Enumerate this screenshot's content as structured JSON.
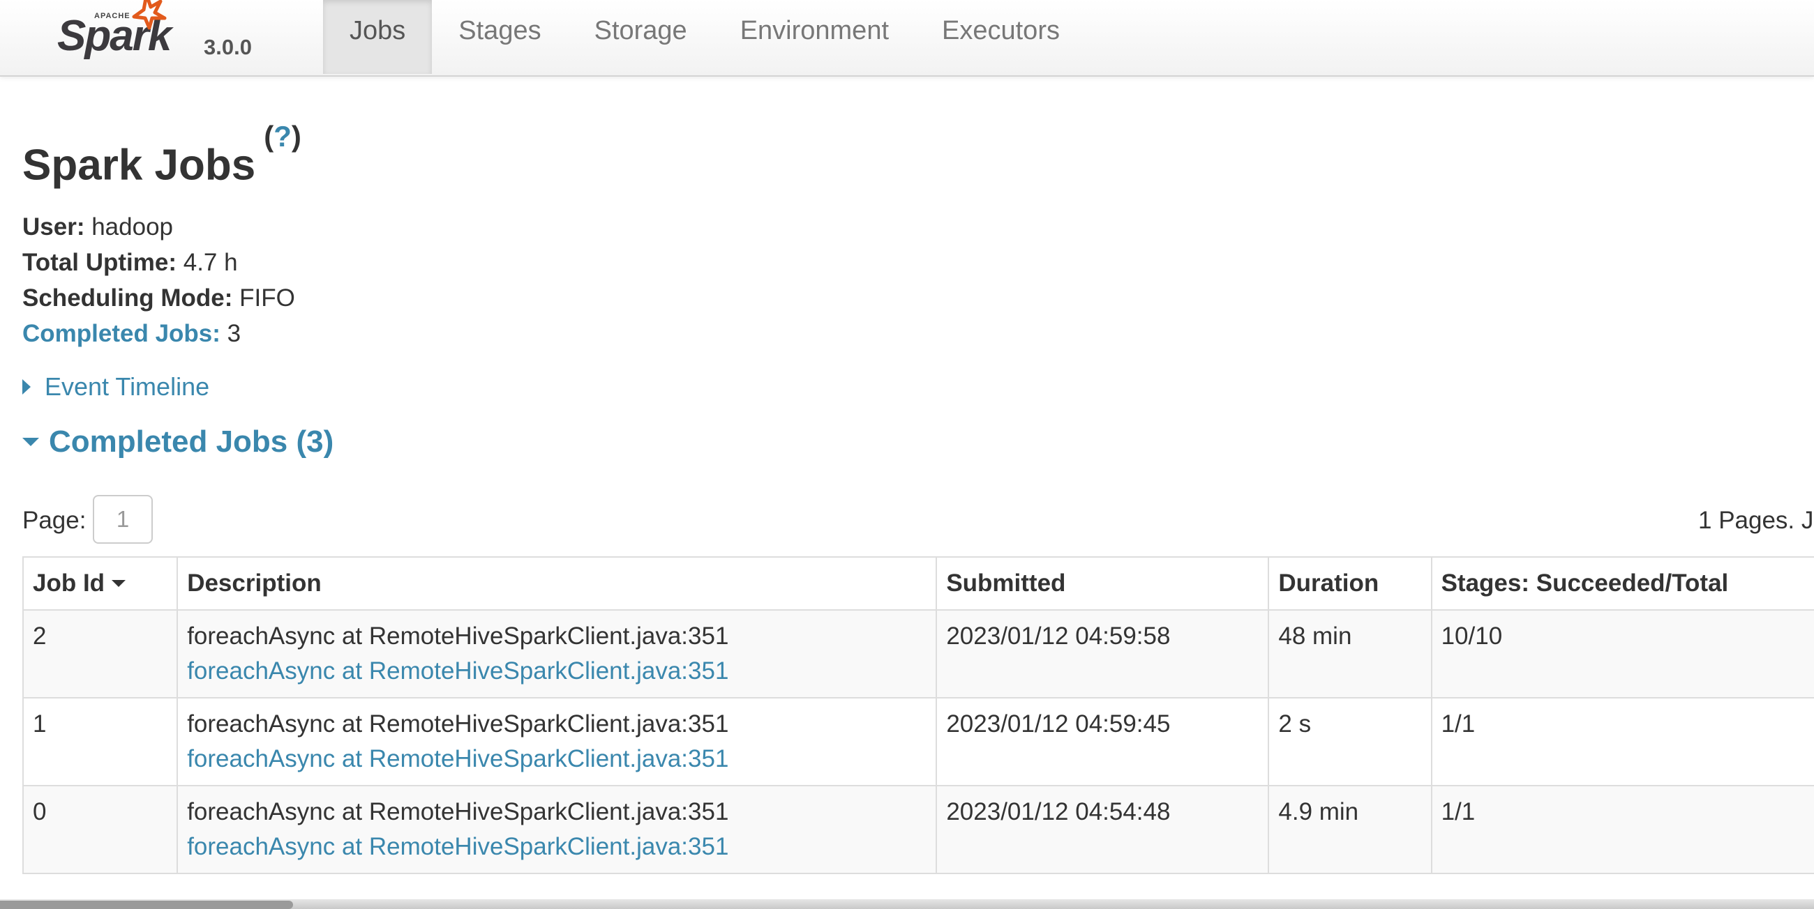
{
  "navbar": {
    "logo_text": "Spark",
    "logo_small_text": "APACHE",
    "version": "3.0.0",
    "tabs": [
      {
        "label": "Jobs",
        "active": true
      },
      {
        "label": "Stages",
        "active": false
      },
      {
        "label": "Storage",
        "active": false
      },
      {
        "label": "Environment",
        "active": false
      },
      {
        "label": "Executors",
        "active": false
      }
    ]
  },
  "page": {
    "title": "Spark Jobs",
    "help_open": "(",
    "help_q": "?",
    "help_close": ")"
  },
  "summary": {
    "user_label": "User:",
    "user_value": " hadoop",
    "uptime_label": "Total Uptime:",
    "uptime_value": " 4.7 h",
    "mode_label": "Scheduling Mode:",
    "mode_value": " FIFO",
    "completed_label": "Completed Jobs:",
    "completed_value": " 3"
  },
  "event_timeline": {
    "label": "Event Timeline"
  },
  "completed_section": {
    "label": "Completed Jobs (3)"
  },
  "pagination": {
    "page_label": "Page:",
    "page_value": "1",
    "pages_info": "1 Pages. J"
  },
  "table": {
    "headers": {
      "job_id": "Job Id",
      "description": "Description",
      "submitted": "Submitted",
      "duration": "Duration",
      "stages": "Stages: Succeeded/Total"
    },
    "rows": [
      {
        "job_id": "2",
        "desc_text": "foreachAsync at RemoteHiveSparkClient.java:351",
        "desc_link": "foreachAsync at RemoteHiveSparkClient.java:351",
        "submitted": "2023/01/12 04:59:58",
        "duration": "48 min",
        "stages": "10/10"
      },
      {
        "job_id": "1",
        "desc_text": "foreachAsync at RemoteHiveSparkClient.java:351",
        "desc_link": "foreachAsync at RemoteHiveSparkClient.java:351",
        "submitted": "2023/01/12 04:59:45",
        "duration": "2 s",
        "stages": "1/1"
      },
      {
        "job_id": "0",
        "desc_text": "foreachAsync at RemoteHiveSparkClient.java:351",
        "desc_link": "foreachAsync at RemoteHiveSparkClient.java:351",
        "submitted": "2023/01/12 04:54:48",
        "duration": "4.9 min",
        "stages": "1/1"
      }
    ]
  },
  "colors": {
    "link": "#3a87ad",
    "text": "#333333",
    "logo_star": "#e25a1c",
    "active_tab_bg": "#e5e5e5"
  }
}
